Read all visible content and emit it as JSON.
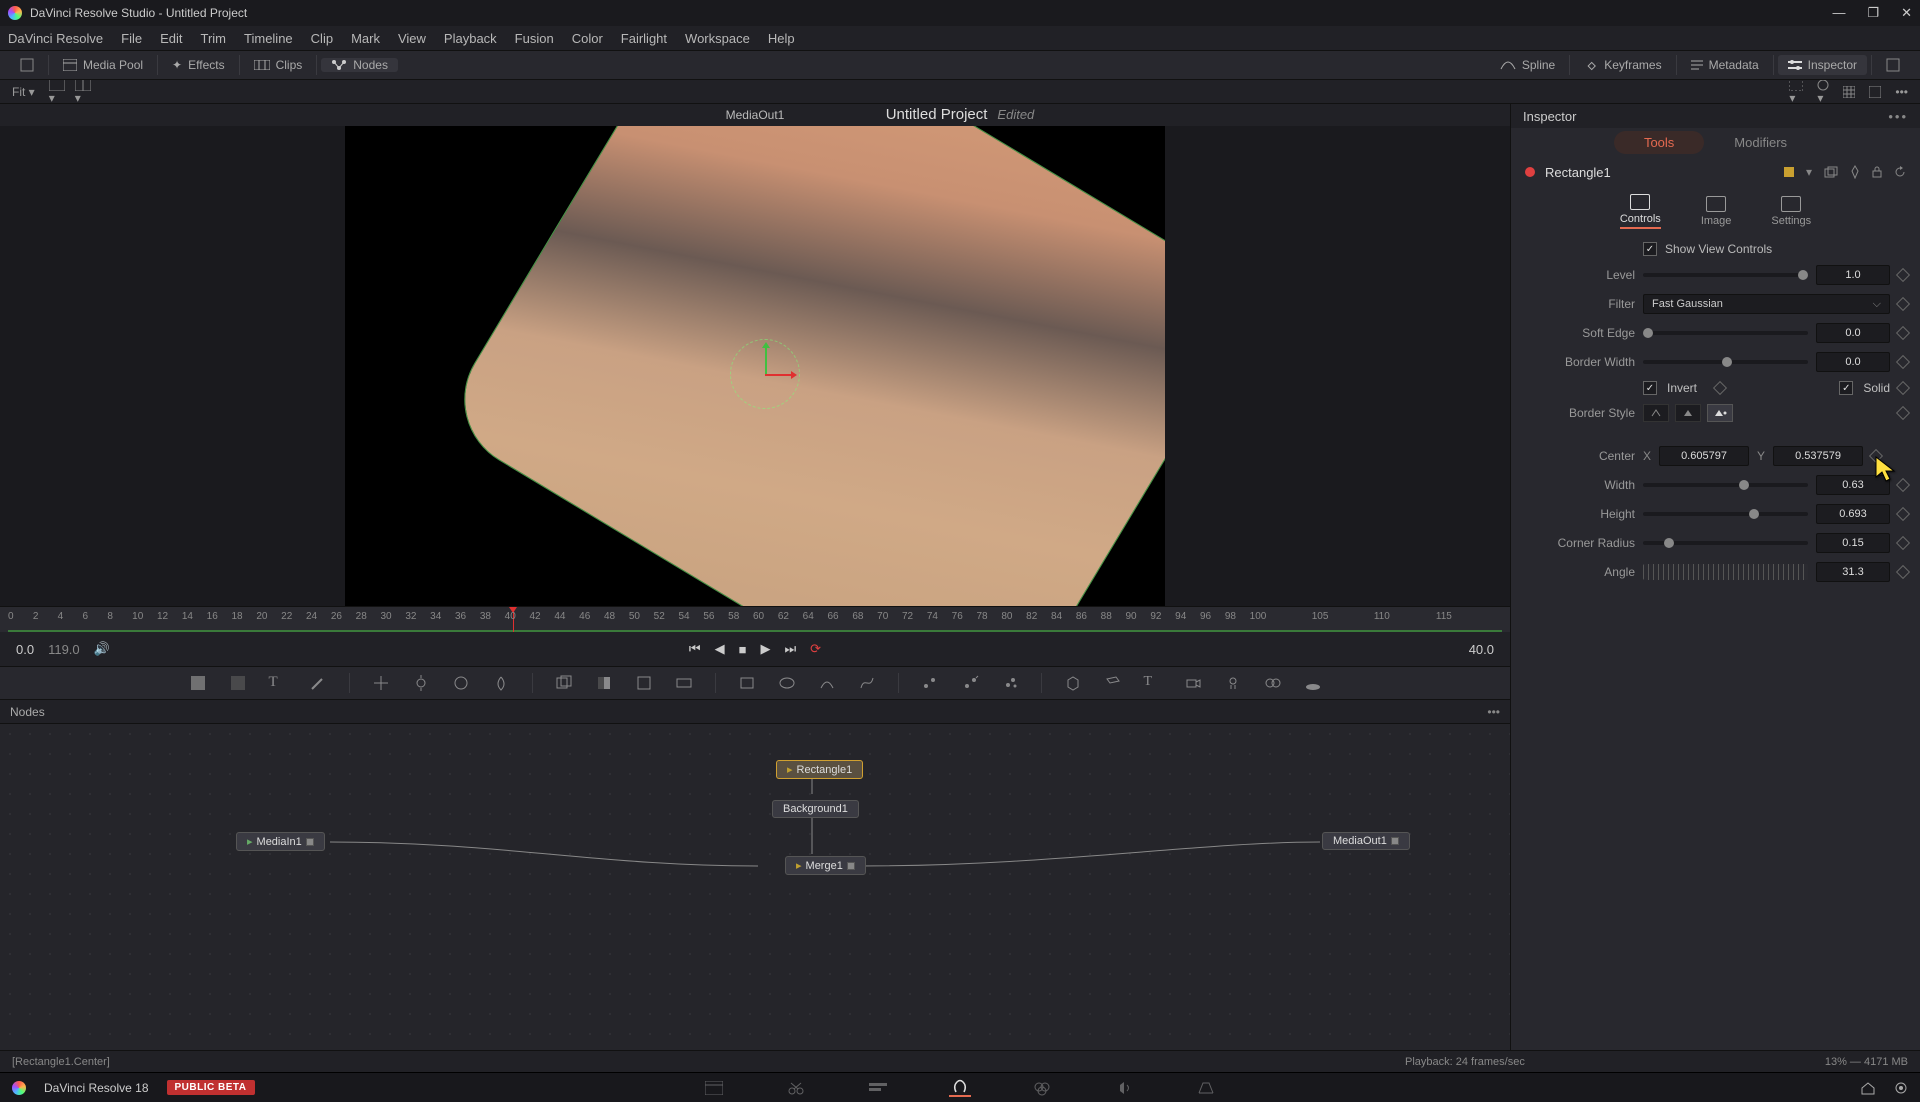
{
  "window": {
    "title": "DaVinci Resolve Studio - Untitled Project"
  },
  "menus": [
    "DaVinci Resolve",
    "File",
    "Edit",
    "Trim",
    "Timeline",
    "Clip",
    "Mark",
    "View",
    "Playback",
    "Fusion",
    "Color",
    "Fairlight",
    "Workspace",
    "Help"
  ],
  "toolbar": {
    "media_pool": "Media Pool",
    "effects": "Effects",
    "clips": "Clips",
    "nodes": "Nodes",
    "spline": "Spline",
    "keyframes": "Keyframes",
    "metadata": "Metadata",
    "inspector": "Inspector"
  },
  "project": {
    "name": "Untitled Project",
    "edited": "Edited"
  },
  "subbar": {
    "fit": "Fit"
  },
  "viewer": {
    "label": "MediaOut1"
  },
  "ruler": {
    "ticks": [
      0,
      2,
      4,
      6,
      8,
      10,
      12,
      14,
      16,
      18,
      20,
      22,
      24,
      26,
      28,
      30,
      32,
      34,
      36,
      38,
      40,
      42,
      44,
      46,
      48,
      50,
      52,
      54,
      56,
      58,
      60,
      62,
      64,
      66,
      68,
      70,
      72,
      74,
      76,
      78,
      80,
      82,
      84,
      86,
      88,
      90,
      92,
      94,
      96,
      98,
      100,
      105,
      110,
      115
    ],
    "outlabel": "119"
  },
  "transport": {
    "in": "0.0",
    "out": "119.0",
    "current": "40.0"
  },
  "nodes_panel": {
    "title": "Nodes",
    "nodes": {
      "rectangle": "Rectangle1",
      "background": "Background1",
      "mediain": "MediaIn1",
      "merge": "Merge1",
      "mediaout": "MediaOut1"
    }
  },
  "inspector": {
    "title": "Inspector",
    "tabs": {
      "tools": "Tools",
      "modifiers": "Modifiers"
    },
    "node": "Rectangle1",
    "subtabs": {
      "controls": "Controls",
      "image": "Image",
      "settings": "Settings"
    },
    "show_view_controls": "Show View Controls",
    "level": {
      "label": "Level",
      "value": "1.0"
    },
    "filter": {
      "label": "Filter",
      "value": "Fast Gaussian"
    },
    "softedge": {
      "label": "Soft Edge",
      "value": "0.0"
    },
    "borderwidth": {
      "label": "Border Width",
      "value": "0.0"
    },
    "invert": "Invert",
    "solid": "Solid",
    "borderstyle": "Border Style",
    "center": {
      "label": "Center",
      "xlabel": "X",
      "x": "0.605797",
      "ylabel": "Y",
      "y": "0.537579"
    },
    "width": {
      "label": "Width",
      "value": "0.63"
    },
    "height": {
      "label": "Height",
      "value": "0.693"
    },
    "corner": {
      "label": "Corner Radius",
      "value": "0.15"
    },
    "angle": {
      "label": "Angle",
      "value": "31.3"
    }
  },
  "status": {
    "left": "[Rectangle1.Center]",
    "playback": "Playback: 24 frames/sec",
    "mem": "13% — 4171 MB"
  },
  "pagebar": {
    "app": "DaVinci Resolve 18",
    "beta": "PUBLIC BETA"
  }
}
